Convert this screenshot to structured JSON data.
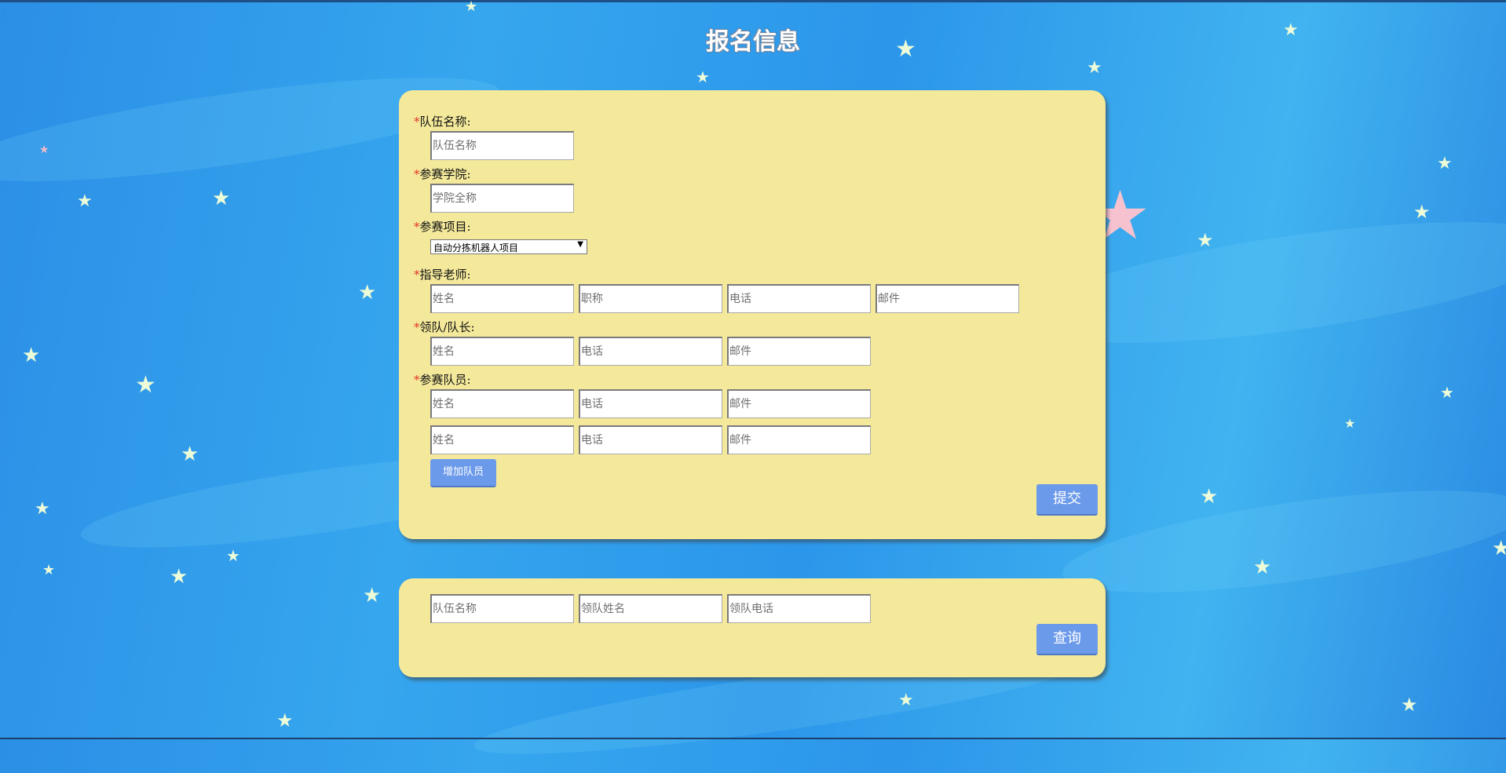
{
  "page": {
    "title": "报名信息"
  },
  "form": {
    "required_mark": "*",
    "team_name": {
      "label": "队伍名称:",
      "placeholder": "队伍名称"
    },
    "college": {
      "label": "参赛学院:",
      "placeholder": "学院全称"
    },
    "project": {
      "label": "参赛项目:",
      "selected": "自动分拣机器人项目",
      "arrow": "▼"
    },
    "advisor": {
      "label": "指导老师:",
      "name_placeholder": "姓名",
      "title_placeholder": "职称",
      "phone_placeholder": "电话",
      "email_placeholder": "邮件"
    },
    "leader": {
      "label": "领队/队长:",
      "name_placeholder": "姓名",
      "phone_placeholder": "电话",
      "email_placeholder": "邮件"
    },
    "members": {
      "label": "参赛队员:",
      "rows": [
        {
          "name_placeholder": "姓名",
          "phone_placeholder": "电话",
          "email_placeholder": "邮件"
        },
        {
          "name_placeholder": "姓名",
          "phone_placeholder": "电话",
          "email_placeholder": "邮件"
        }
      ]
    },
    "add_member_label": "增加队员",
    "submit_label": "提交"
  },
  "search": {
    "team_placeholder": "队伍名称",
    "leader_name_placeholder": "领队姓名",
    "leader_phone_placeholder": "领队电话",
    "query_label": "查询"
  },
  "theme": {
    "panel_color": "#f4e99b",
    "button_color": "#6c9aea",
    "required_color": "#e0352b",
    "background_color": "#2d95e8"
  }
}
